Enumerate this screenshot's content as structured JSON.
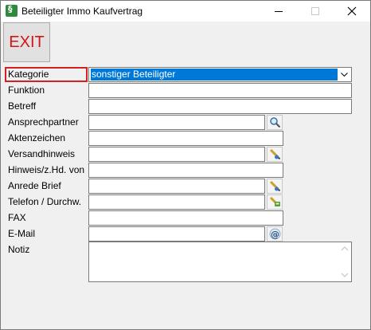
{
  "window": {
    "title": "Beteiligter Immo Kaufvertrag",
    "icon": "app-paragraph-icon"
  },
  "toolbar": {
    "exit_label": "EXIT"
  },
  "form": {
    "kategorie": {
      "label": "Kategorie",
      "value": "sonstiger Beteiligter"
    },
    "funktion": {
      "label": "Funktion",
      "value": ""
    },
    "betreff": {
      "label": "Betreff",
      "value": ""
    },
    "ansprechpartner": {
      "label": "Ansprechpartner",
      "value": "",
      "button_icon": "search-icon"
    },
    "aktenzeichen": {
      "label": "Aktenzeichen",
      "value": ""
    },
    "versandhinweis": {
      "label": "Versandhinweis",
      "value": "",
      "button_icon": "pencil-icon"
    },
    "hinweis": {
      "label": "Hinweis/z.Hd. von",
      "value": ""
    },
    "anrede": {
      "label": "Anrede Brief",
      "value": "",
      "button_icon": "pencil-icon"
    },
    "telefon": {
      "label": "Telefon / Durchw.",
      "value": "",
      "button_icon": "phone-icon"
    },
    "fax": {
      "label": "FAX",
      "value": ""
    },
    "email": {
      "label": "E-Mail",
      "value": "",
      "button_icon": "at-icon"
    },
    "notiz": {
      "label": "Notiz",
      "value": ""
    }
  },
  "colors": {
    "selection": "#0078d7",
    "exit_text": "#d31515",
    "focus_border": "#d62020"
  }
}
